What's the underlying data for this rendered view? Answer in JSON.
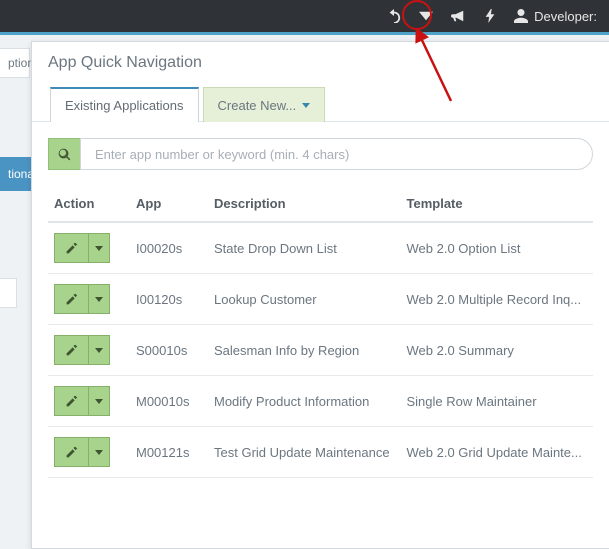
{
  "topbar": {
    "developer_label": "Developer:"
  },
  "sidebar": {
    "frag1": "ption",
    "frag2": "tiona"
  },
  "panel": {
    "title": "App Quick Navigation",
    "tabs": {
      "existing": "Existing Applications",
      "create": "Create New..."
    },
    "search_placeholder": "Enter app number or keyword (min. 4 chars)"
  },
  "table": {
    "headers": {
      "action": "Action",
      "app": "App",
      "description": "Description",
      "template": "Template"
    },
    "rows": [
      {
        "app": "I00020s",
        "description": "State Drop Down List",
        "template": "Web 2.0 Option List"
      },
      {
        "app": "I00120s",
        "description": "Lookup Customer",
        "template": "Web 2.0 Multiple Record Inq..."
      },
      {
        "app": "S00010s",
        "description": "Salesman Info by Region",
        "template": "Web 2.0 Summary"
      },
      {
        "app": "M00010s",
        "description": "Modify Product Information",
        "template": "Single Row Maintainer"
      },
      {
        "app": "M00121s",
        "description": "Test Grid Update Maintenance",
        "template": "Web 2.0 Grid Update Mainte..."
      }
    ]
  }
}
